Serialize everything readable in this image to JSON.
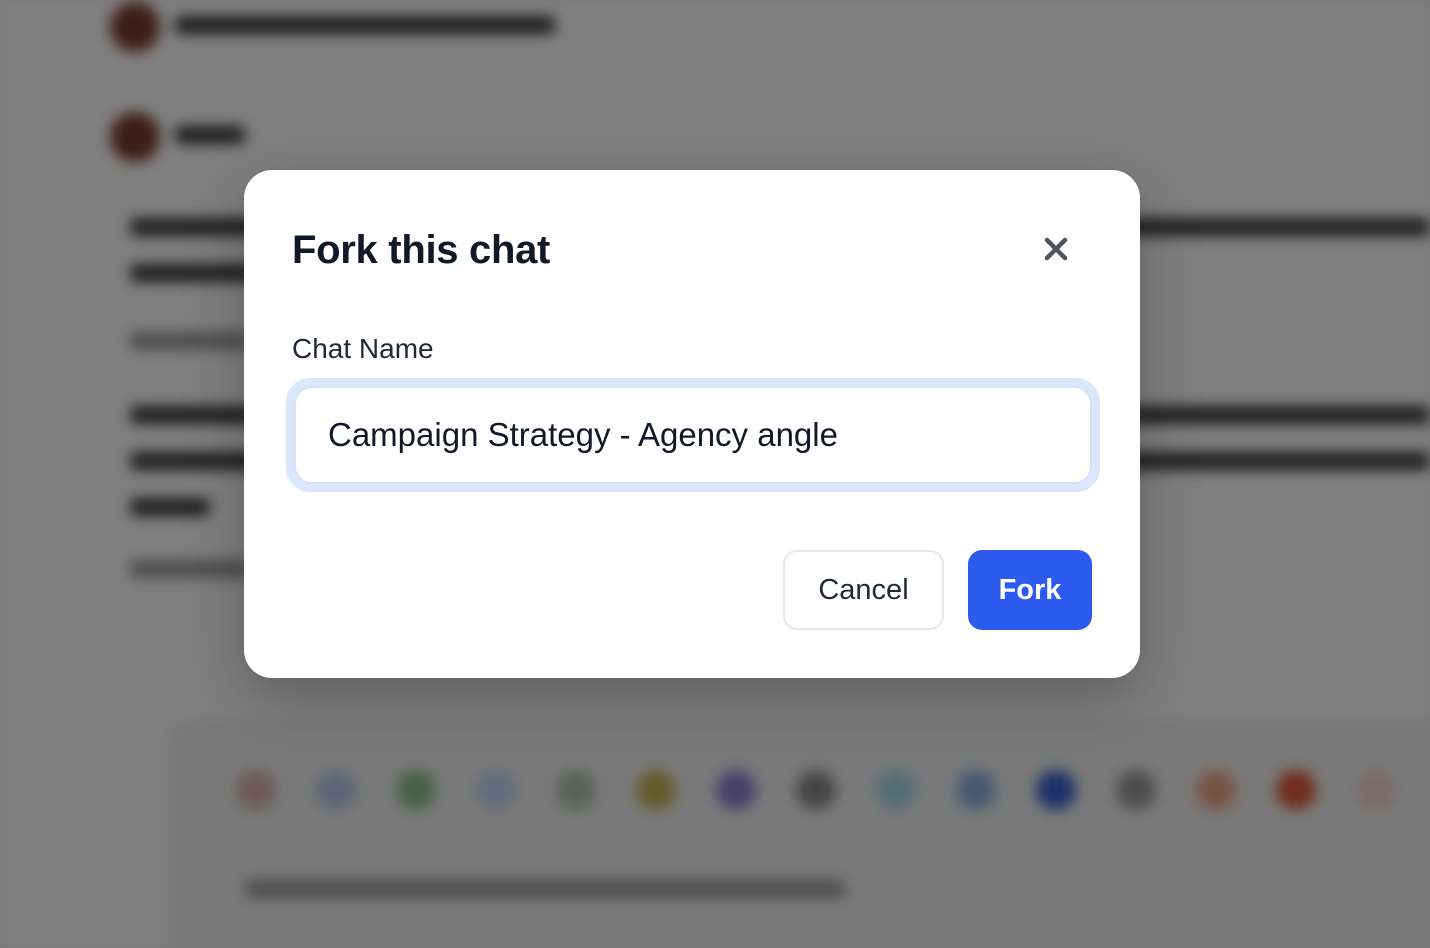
{
  "modal": {
    "title": "Fork this chat",
    "close_icon": "close-icon",
    "field_label": "Chat Name",
    "chat_name_value": "Campaign Strategy - Agency angle",
    "cancel_label": "Cancel",
    "fork_label": "Fork"
  },
  "colors": {
    "primary": "#2d5bf0",
    "title_text": "#111827",
    "overlay": "rgba(0,0,0,0.5)",
    "input_focus_ring": "#dbe7fb"
  }
}
